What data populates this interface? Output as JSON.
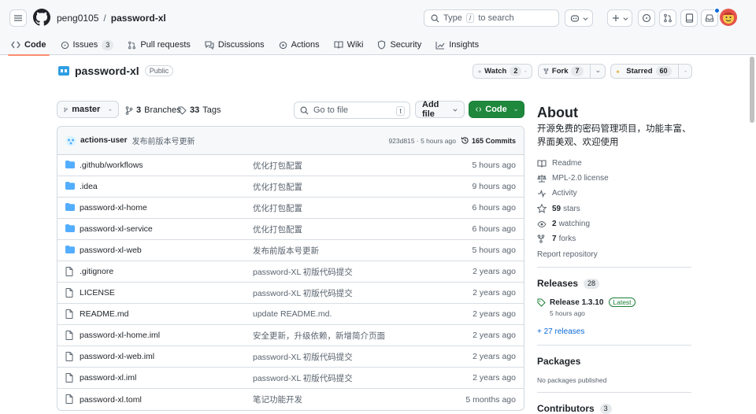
{
  "nav": {
    "owner": "peng0105",
    "separator": "/",
    "repo": "password-xl",
    "search_prefix": "Type",
    "search_key": "/",
    "search_suffix": "to search"
  },
  "tabs": [
    {
      "label": "Code",
      "icon": "code-icon"
    },
    {
      "label": "Issues",
      "count": "3",
      "icon": "issue-icon"
    },
    {
      "label": "Pull requests",
      "icon": "pull-request-icon"
    },
    {
      "label": "Discussions",
      "icon": "discussion-icon"
    },
    {
      "label": "Actions",
      "icon": "play-icon"
    },
    {
      "label": "Wiki",
      "icon": "book-icon"
    },
    {
      "label": "Security",
      "icon": "shield-icon"
    },
    {
      "label": "Insights",
      "icon": "graph-icon"
    }
  ],
  "repo_header": {
    "name": "password-xl",
    "visibility": "Public",
    "watch_label": "Watch",
    "watch_count": "2",
    "fork_label": "Fork",
    "fork_count": "7",
    "star_label": "Starred",
    "star_count": "60"
  },
  "toolbar": {
    "branch": "master",
    "branches_count": "3",
    "branches_label": "Branches",
    "tags_count": "33",
    "tags_label": "Tags",
    "goto_placeholder": "Go to file",
    "goto_key": "t",
    "add_file": "Add file",
    "code": "Code"
  },
  "latest_commit": {
    "user": "actions-user",
    "message": "发布前版本号更新",
    "sha_time": "923d815 · 5 hours ago",
    "commits": "165 Commits"
  },
  "files": [
    {
      "name": ".github/workflows",
      "type": "dir",
      "message": "优化打包配置",
      "time": "5 hours ago"
    },
    {
      "name": ".idea",
      "type": "dir",
      "message": "优化打包配置",
      "time": "9 hours ago"
    },
    {
      "name": "password-xl-home",
      "type": "dir",
      "message": "优化打包配置",
      "time": "6 hours ago"
    },
    {
      "name": "password-xl-service",
      "type": "dir",
      "message": "优化打包配置",
      "time": "6 hours ago"
    },
    {
      "name": "password-xl-web",
      "type": "dir",
      "message": "发布前版本号更新",
      "time": "5 hours ago"
    },
    {
      "name": ".gitignore",
      "type": "file",
      "message": "password-XL 初版代码提交",
      "time": "2 years ago"
    },
    {
      "name": "LICENSE",
      "type": "file",
      "message": "password-XL 初版代码提交",
      "time": "2 years ago"
    },
    {
      "name": "README.md",
      "type": "file",
      "message": "update README.md.",
      "time": "2 years ago"
    },
    {
      "name": "password-xl-home.iml",
      "type": "file",
      "message": "安全更新，升级依赖，新增简介页面",
      "time": "2 years ago"
    },
    {
      "name": "password-xl-web.iml",
      "type": "file",
      "message": "password-XL 初版代码提交",
      "time": "2 years ago"
    },
    {
      "name": "password-xl.iml",
      "type": "file",
      "message": "password-XL 初版代码提交",
      "time": "2 years ago"
    },
    {
      "name": "password-xl.toml",
      "type": "file",
      "message": "笔记功能开发",
      "time": "5 months ago"
    }
  ],
  "about": {
    "title": "About",
    "description": "开源免费的密码管理项目，功能丰富、界面美观、欢迎使用",
    "readme": "Readme",
    "license": "MPL-2.0 license",
    "activity": "Activity",
    "stars_count": "59",
    "stars_label": "stars",
    "watching_count": "2",
    "watching_label": "watching",
    "forks_count": "7",
    "forks_label": "forks",
    "report": "Report repository"
  },
  "releases": {
    "title": "Releases",
    "count": "28",
    "latest_name": "Release 1.3.10",
    "latest_badge": "Latest",
    "latest_time": "5 hours ago",
    "more": "+ 27 releases"
  },
  "packages": {
    "title": "Packages",
    "empty": "No packages published"
  },
  "contributors": {
    "title": "Contributors",
    "count": "3"
  },
  "colors": {
    "accent_green": "#1f883d",
    "link_blue": "#0969da",
    "folder_blue": "#54aeff",
    "tab_underline": "#fd8c73"
  }
}
